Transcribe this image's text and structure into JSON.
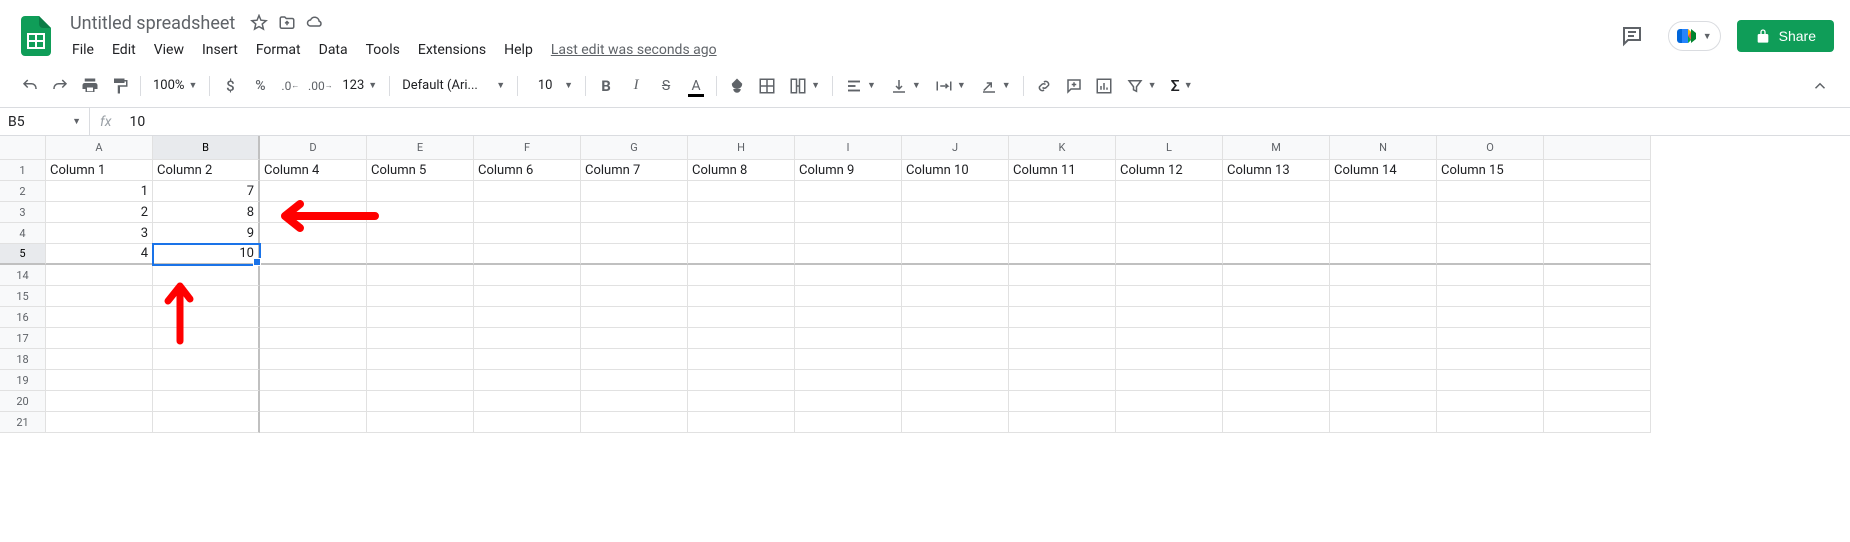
{
  "doc": {
    "title": "Untitled spreadsheet",
    "last_edit": "Last edit was seconds ago"
  },
  "menus": [
    "File",
    "Edit",
    "View",
    "Insert",
    "Format",
    "Data",
    "Tools",
    "Extensions",
    "Help"
  ],
  "share": {
    "label": "Share"
  },
  "toolbar": {
    "zoom": "100%",
    "more_fmt": "123",
    "font": "Default (Ari...",
    "font_size": "10"
  },
  "name_box": "B5",
  "formula_value": "10",
  "columns": [
    "A",
    "B",
    "D",
    "E",
    "F",
    "G",
    "H",
    "I",
    "J",
    "K",
    "L",
    "M",
    "N",
    "O",
    ""
  ],
  "rows": [
    "1",
    "2",
    "3",
    "4",
    "5",
    "14",
    "15",
    "16",
    "17",
    "18",
    "19",
    "20",
    "21"
  ],
  "selected_cell": "B5",
  "data": {
    "headers": [
      "Column 1",
      "Column 2",
      "Column 4",
      "Column 5",
      "Column 6",
      "Column 7",
      "Column 8",
      "Column 9",
      "Column 10",
      "Column 11",
      "Column 12",
      "Column 13",
      "Column 14",
      "Column 15"
    ],
    "col_a": [
      "1",
      "2",
      "3",
      "4"
    ],
    "col_b": [
      "7",
      "8",
      "9",
      "10"
    ]
  }
}
